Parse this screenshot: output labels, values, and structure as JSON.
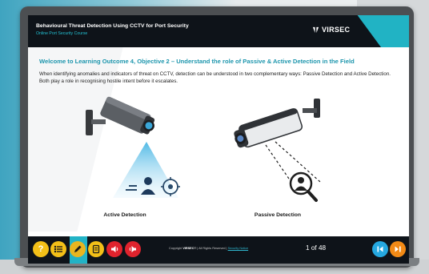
{
  "header": {
    "title": "Behavioural Threat Detection Using CCTV for Port Security",
    "subtitle": "Online Port Security Course",
    "brand": "VIRSEC"
  },
  "content": {
    "heading": "Welcome to Learning Outcome 4, Objective 2 – Understand the role of Passive & Active Detection in the Field",
    "intro": "When identifying anomalies and indicators of threat on CCTV, detection can be understood in two complementary ways: Passive Detection and Active Detection. Both play a role in recognising hostile intent before it escalates.",
    "active_label": "Active Detection",
    "passive_label": "Passive Detection"
  },
  "footer": {
    "copyright_prefix": "Copyright ",
    "copyright_brand": "VIRSEC",
    "copyright_mid": "® | All Rights Reserved | ",
    "privacy_link": "Security Notice",
    "page_current": "1",
    "page_of": "of",
    "page_total": "48",
    "help_glyph": "?"
  },
  "colors": {
    "accent": "#23b5c7",
    "heading": "#1d96ad",
    "help": "#f3c018",
    "menu": "#f3c018",
    "pencil": "#e8b520",
    "notes": "#f3c018",
    "audio": "#e0232d",
    "first_page": "#25a8e0",
    "next_page": "#f28a16"
  },
  "icons": [
    "help-icon",
    "menu-list-icon",
    "pencil-icon",
    "notes-icon",
    "audio-prev-icon",
    "audio-next-icon",
    "first-page-icon",
    "next-page-icon"
  ]
}
